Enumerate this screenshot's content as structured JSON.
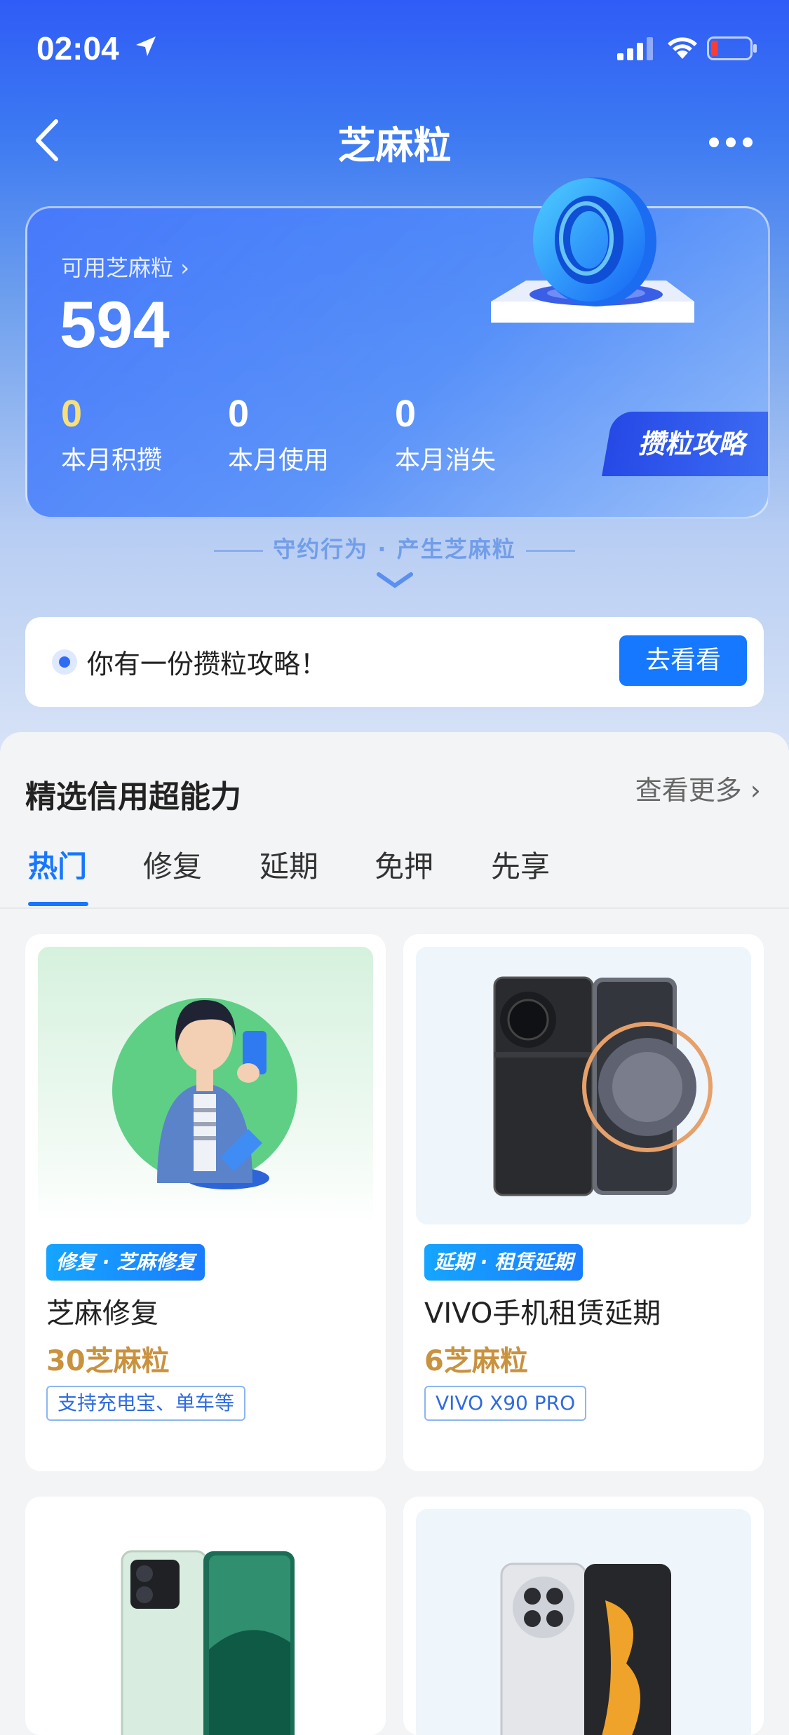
{
  "status_bar": {
    "time": "02:04"
  },
  "nav": {
    "title": "芝麻粒"
  },
  "card": {
    "available_label": "可用芝麻粒",
    "points": "594",
    "stats": [
      {
        "value": "0",
        "label": "本月积攒"
      },
      {
        "value": "0",
        "label": "本月使用"
      },
      {
        "value": "0",
        "label": "本月消失"
      }
    ],
    "strategy_button": "攒粒攻略"
  },
  "slogan": "守约行为 · 产生芝麻粒",
  "notice": {
    "text": "你有一份攒粒攻略！",
    "button": "去看看"
  },
  "section": {
    "title": "精选信用超能力",
    "see_more": "查看更多",
    "tabs": [
      "热门",
      "修复",
      "延期",
      "免押",
      "先享"
    ]
  },
  "products": [
    {
      "tag": "修复 · 芝麻修复",
      "name": "芝麻修复",
      "price": "30芝麻粒",
      "note": "支持充电宝、单车等"
    },
    {
      "tag": "延期 · 租赁延期",
      "name": "VIVO手机租赁延期",
      "price": "6芝麻粒",
      "note": "VIVO X90 PRO"
    }
  ],
  "colors": {
    "accent": "#1677ff",
    "price": "#c9923f",
    "hero_top": "#2f5cf6"
  }
}
